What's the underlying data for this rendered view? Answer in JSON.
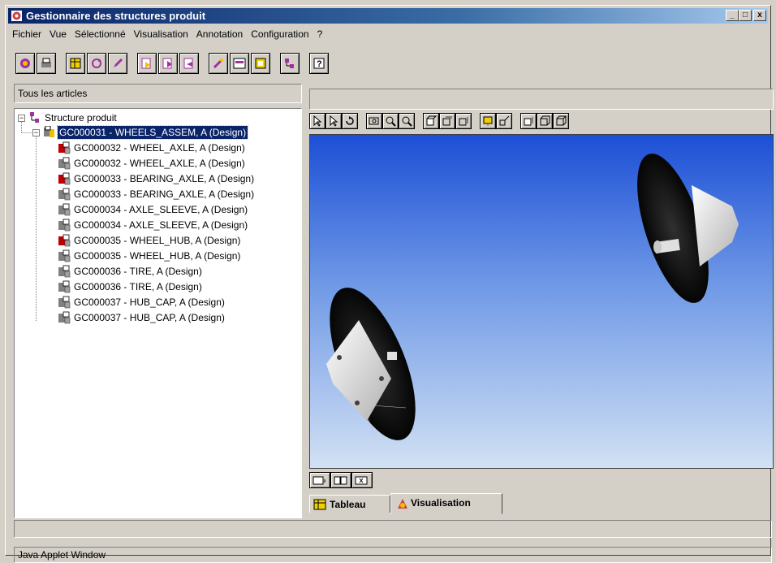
{
  "window": {
    "title": "Gestionnaire des structures produit",
    "min": "_",
    "max": "□",
    "close": "x"
  },
  "menu": [
    "Fichier",
    "Vue",
    "Sélectionné",
    "Visualisation",
    "Annotation",
    "Configuration",
    "?"
  ],
  "left_panel": {
    "header": "Tous les articles"
  },
  "tree": {
    "root": "Structure produit",
    "assembly": "GC000031 - WHEELS_ASSEM, A (Design)",
    "items": [
      {
        "label": "GC000032 - WHEEL_AXLE, A (Design)",
        "icon": "part-red-icon"
      },
      {
        "label": "GC000032 - WHEEL_AXLE, A (Design)",
        "icon": "part-gray-icon"
      },
      {
        "label": "GC000033 - BEARING_AXLE, A (Design)",
        "icon": "part-red-icon"
      },
      {
        "label": "GC000033 - BEARING_AXLE, A (Design)",
        "icon": "part-gray-icon"
      },
      {
        "label": "GC000034 - AXLE_SLEEVE, A (Design)",
        "icon": "part-gray-icon"
      },
      {
        "label": "GC000034 - AXLE_SLEEVE, A (Design)",
        "icon": "part-gray-icon"
      },
      {
        "label": "GC000035 - WHEEL_HUB, A (Design)",
        "icon": "part-red-icon"
      },
      {
        "label": "GC000035 - WHEEL_HUB, A (Design)",
        "icon": "part-gray-icon"
      },
      {
        "label": "GC000036 - TIRE, A (Design)",
        "icon": "part-gray-icon"
      },
      {
        "label": "GC000036 - TIRE, A (Design)",
        "icon": "part-gray-icon"
      },
      {
        "label": "GC000037 - HUB_CAP, A (Design)",
        "icon": "part-gray-icon"
      },
      {
        "label": "GC000037 - HUB_CAP, A (Design)",
        "icon": "part-gray-icon"
      }
    ]
  },
  "tabs": {
    "tableau": "Tableau",
    "visualisation": "Visualisation",
    "active": "Visualisation"
  },
  "status": {
    "bottom": "Java Applet Window"
  },
  "colors": {
    "title_bar": "#0a246a",
    "selection": "#0a246a",
    "viewport_top": "#1c4fd6",
    "viewport_bottom": "#d2e1f4"
  }
}
